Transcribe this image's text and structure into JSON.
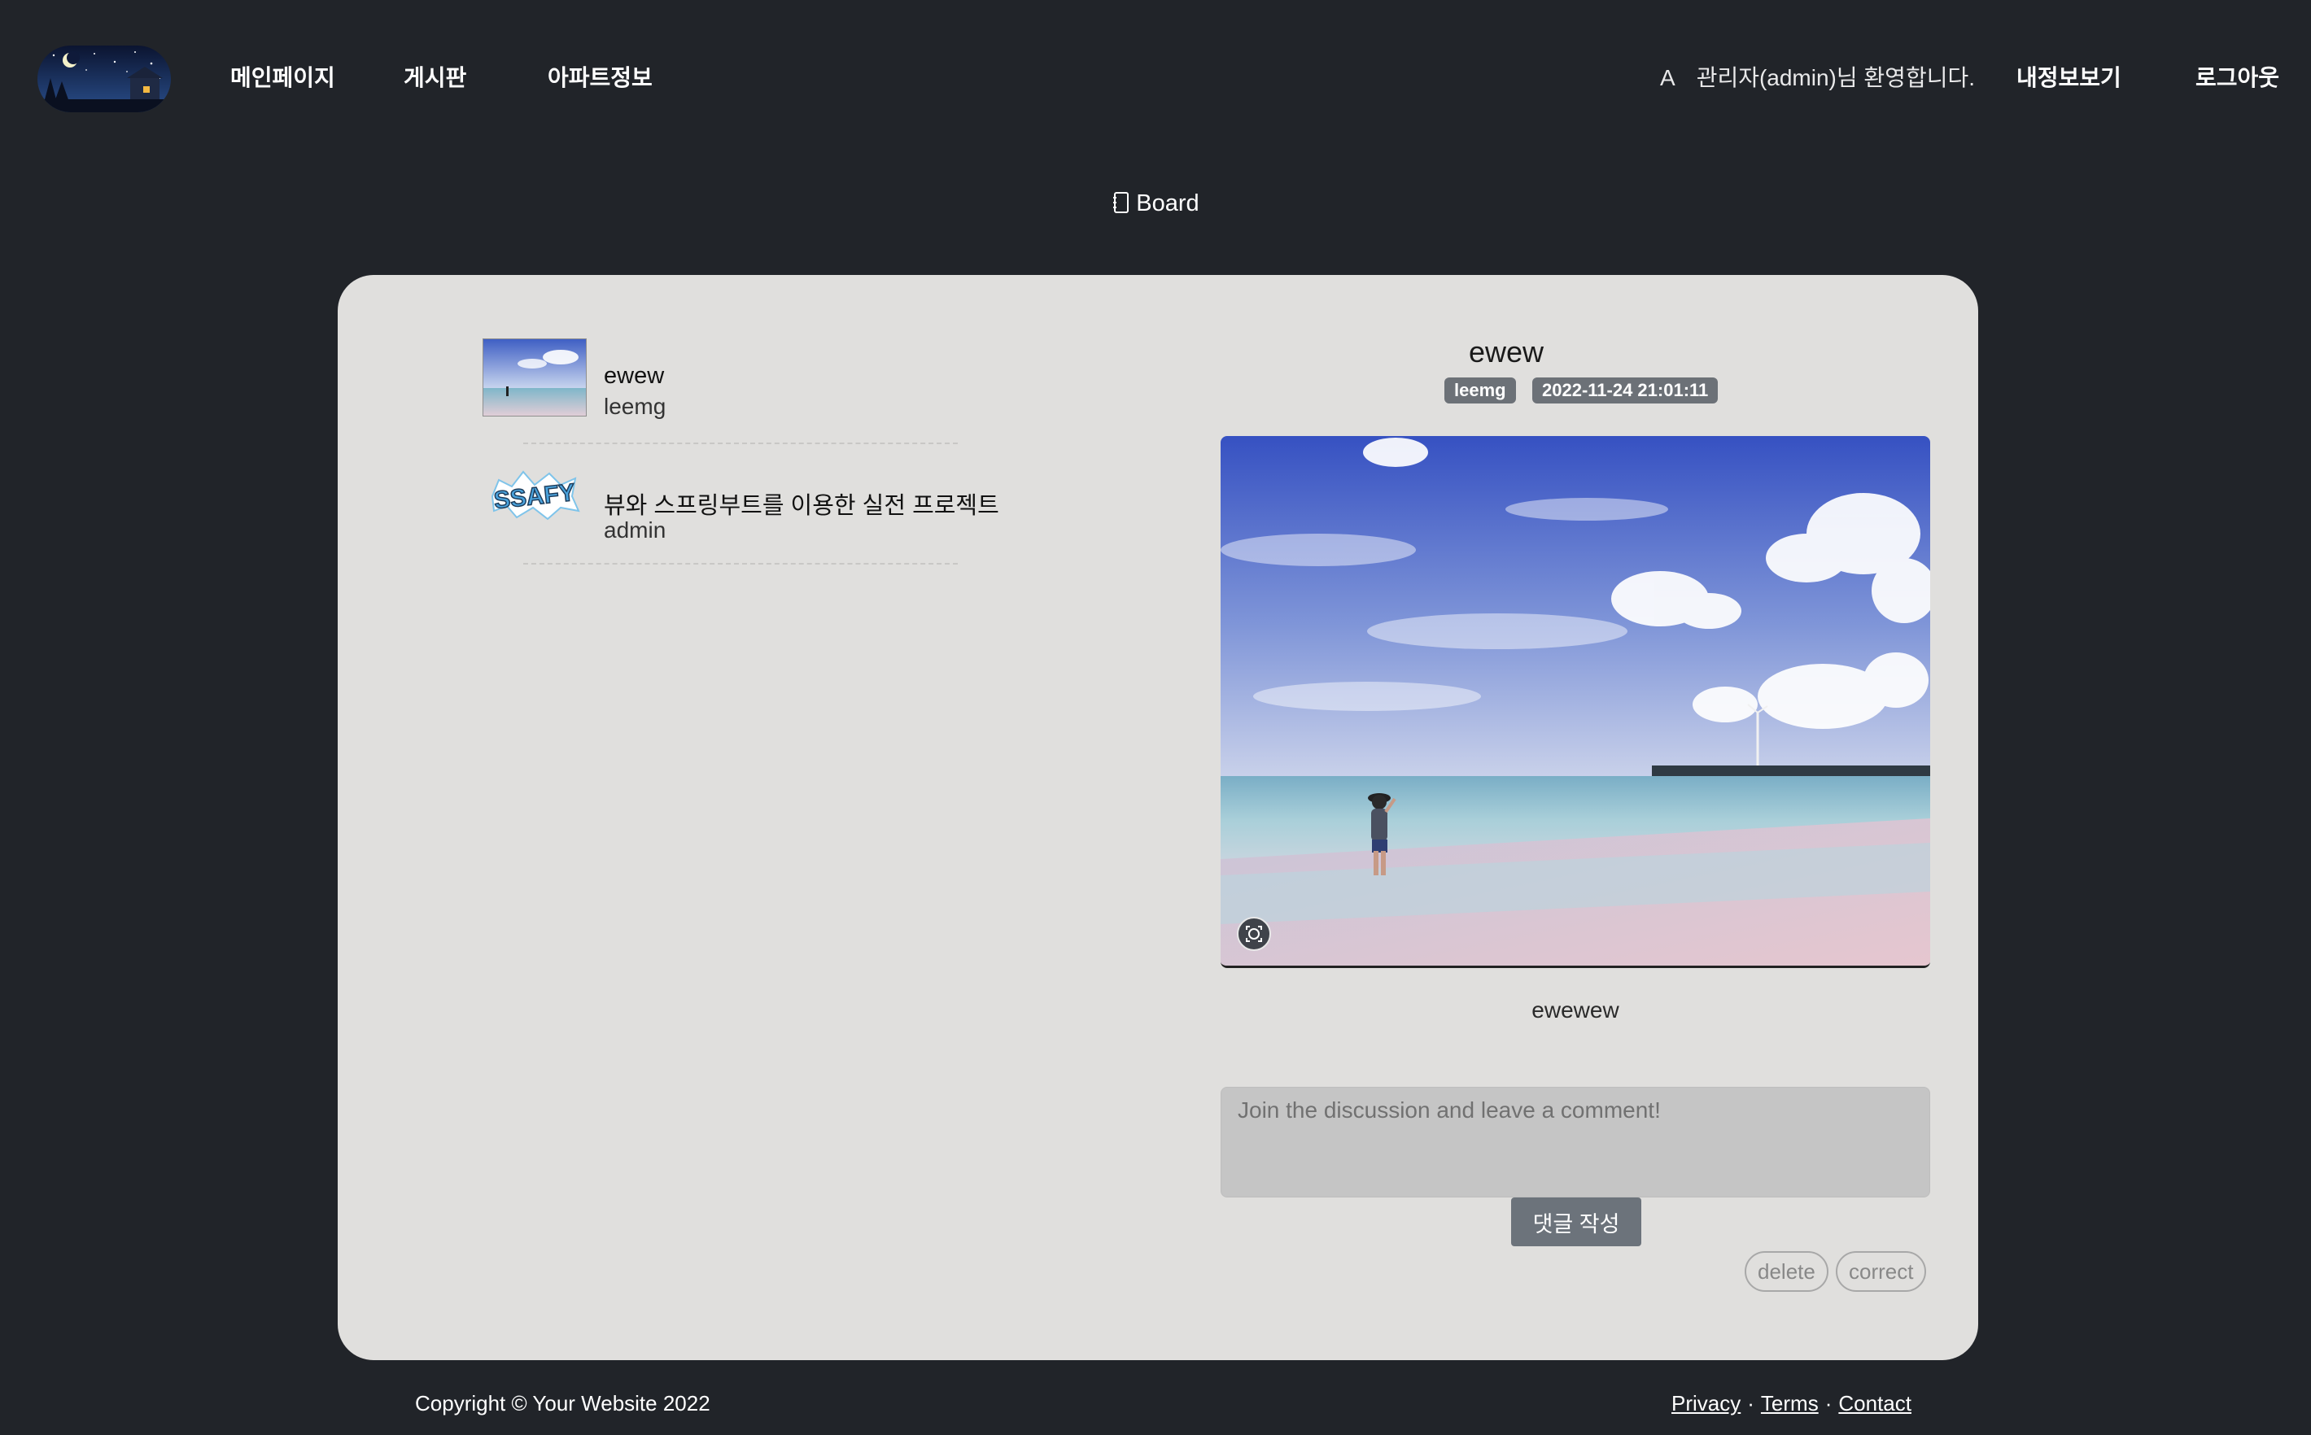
{
  "header": {
    "nav": [
      {
        "label": "메인페이지"
      },
      {
        "label": "게시판"
      },
      {
        "label": "아파트정보"
      }
    ],
    "user_avatar_letter": "A",
    "welcome_text": "관리자(admin)님 환영합니다.",
    "my_info_label": "내정보보기",
    "logout_label": "로그아웃"
  },
  "page": {
    "section_title": "Board"
  },
  "board": {
    "posts": [
      {
        "title": "ewew",
        "author": "leemg",
        "thumb_icon": "beach-photo-thumbnail"
      },
      {
        "title": "뷰와 스프링부트를 이용한 실전 프로젝트",
        "author": "admin",
        "thumb_icon": "ssafy-logo-thumbnail"
      }
    ],
    "detail": {
      "title": "ewew",
      "author_badge": "leemg",
      "date_badge": "2022-11-24 21:01:11",
      "content": "ewewew",
      "comment_placeholder": "Join the discussion and leave a comment!",
      "comment_button": "댓글 작성",
      "delete_label": "delete",
      "correct_label": "correct"
    }
  },
  "footer": {
    "copyright": "Copyright © Your Website 2022",
    "links": [
      {
        "label": "Privacy"
      },
      {
        "label": "Terms"
      },
      {
        "label": "Contact"
      }
    ]
  },
  "colors": {
    "background": "#212429",
    "card": "#e0dfdd",
    "badge": "#6c7177",
    "button": "#6c737b"
  }
}
